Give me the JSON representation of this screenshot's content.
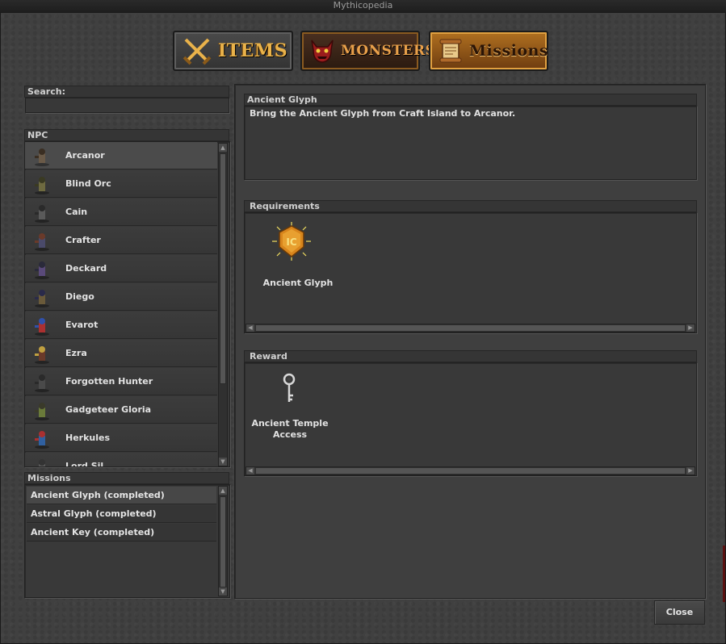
{
  "window": {
    "title": "Mythicopedia"
  },
  "tabs": [
    {
      "label": "Items",
      "icon": "crossed-swords-icon"
    },
    {
      "label": "Monsters",
      "icon": "demon-head-icon"
    },
    {
      "label": "Missions",
      "icon": "scroll-icon"
    }
  ],
  "search": {
    "label": "Search:",
    "value": ""
  },
  "npc": {
    "header": "NPC",
    "items": [
      {
        "name": "Arcanor"
      },
      {
        "name": "Blind Orc"
      },
      {
        "name": "Cain"
      },
      {
        "name": "Crafter"
      },
      {
        "name": "Deckard"
      },
      {
        "name": "Diego"
      },
      {
        "name": "Evarot"
      },
      {
        "name": "Ezra"
      },
      {
        "name": "Forgotten Hunter"
      },
      {
        "name": "Gadgeteer Gloria"
      },
      {
        "name": "Herkules"
      },
      {
        "name": "Lord Sil..."
      }
    ]
  },
  "missions": {
    "header": "Missions",
    "items": [
      {
        "label": "Ancient Glyph (completed)"
      },
      {
        "label": "Astral Glyph (completed)"
      },
      {
        "label": "Ancient Key (completed)"
      }
    ]
  },
  "detail": {
    "title": "Ancient Glyph",
    "description": "Bring the Ancient Glyph from Craft Island to Arcanor.",
    "requirements": {
      "header": "Requirements",
      "items": [
        {
          "name": "Ancient Glyph",
          "icon": "glyph-medallion-icon"
        }
      ]
    },
    "reward": {
      "header": "Reward",
      "items": [
        {
          "name_line1": "Ancient Temple",
          "name_line2": "Access",
          "icon": "key-icon"
        }
      ]
    }
  },
  "buttons": {
    "close": "Close"
  },
  "colors": {
    "accent_gold": "#e9b24a",
    "missions_tab": "#b07020",
    "panel_bg": "#404040"
  }
}
